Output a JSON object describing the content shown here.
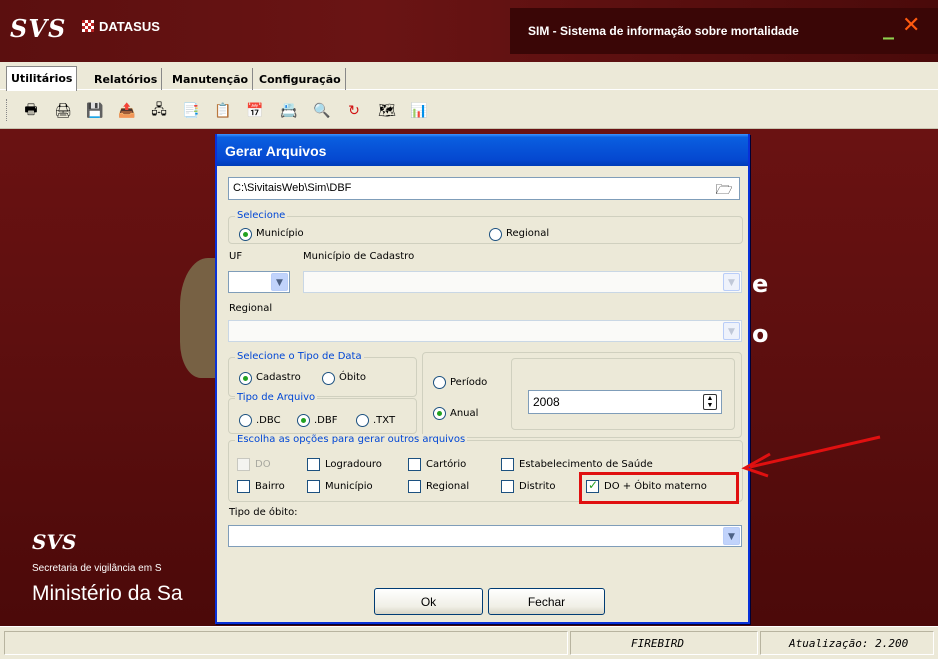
{
  "header": {
    "logo": "SVS",
    "datasus": "DATASUS",
    "app_title": "SIM - Sistema de informação sobre mortalidade",
    "minimize": "_",
    "close": "✕"
  },
  "tabs": [
    "Utilitários",
    "Relatórios",
    "Manutenção",
    "Configuração"
  ],
  "toolbar": {
    "icons": [
      "print-icon",
      "printer-icon",
      "save-icon",
      "export-icon",
      "network-icon",
      "copy-icon",
      "report-icon",
      "calendar-icon",
      "list-icon",
      "search-icon",
      "refresh-icon",
      "map-icon",
      "chart-icon"
    ]
  },
  "background": {
    "letter_e": "e",
    "letter_o": "o",
    "svs": "SVS",
    "secretaria": "Secretaria de vigilância em S",
    "ministerio": "Ministério da Sa"
  },
  "dialog": {
    "title": "Gerar Arquivos",
    "path": "C:\\SivitaisWeb\\Sim\\DBF",
    "selecione": {
      "legend": "Selecione",
      "municipio": "Município",
      "regional": "Regional",
      "selected": "Município"
    },
    "uf_label": "UF",
    "municipio_cadastro_label": "Município de Cadastro",
    "regional_label": "Regional",
    "tipo_data": {
      "legend": "Selecione o Tipo de Data",
      "cadastro": "Cadastro",
      "obito": "Óbito",
      "selected": "Cadastro"
    },
    "tipo_arquivo": {
      "legend": "Tipo de Arquivo",
      "dbc": ".DBC",
      "dbf": ".DBF",
      "txt": ".TXT",
      "selected": ".DBF"
    },
    "periodo": "Período",
    "anual": "Anual",
    "year": "2008",
    "opcoes": {
      "legend": "Escolha as opções para gerar outros arquivos",
      "do": "DO",
      "logradouro": "Logradouro",
      "cartorio": "Cartório",
      "estabelecimento": "Estabelecimento de Saúde",
      "bairro": "Bairro",
      "municipio": "Município",
      "regional": "Regional",
      "distrito": "Distrito",
      "do_obito_materno": "DO + Óbito materno"
    },
    "tipo_obito_label": "Tipo de óbito:",
    "ok": "Ok",
    "fechar": "Fechar"
  },
  "statusbar": {
    "db": "FIREBIRD",
    "version": "Atualização: 2.200"
  },
  "colors": {
    "brand": "#5b0f0f",
    "dialog_title": "#0548d0",
    "legend_text": "#0046d5",
    "annotation": "#e01010"
  }
}
